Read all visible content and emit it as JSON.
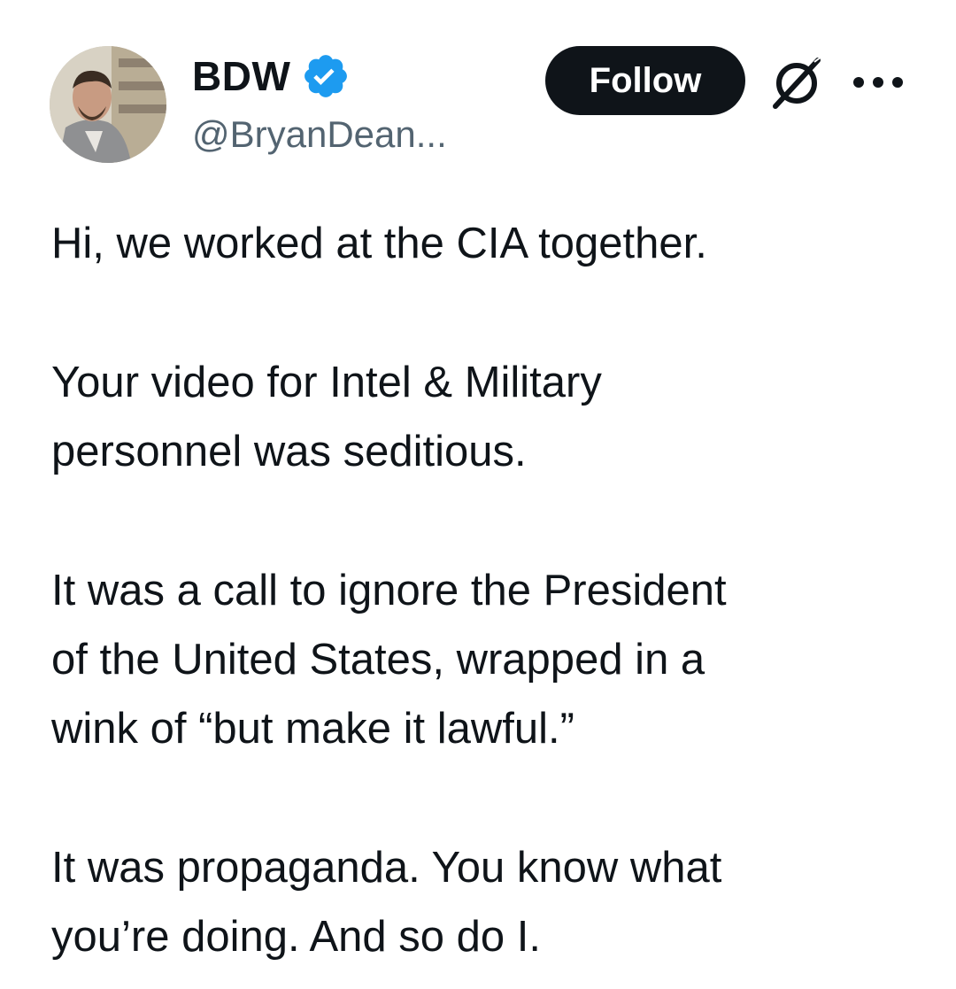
{
  "author": {
    "display_name": "BDW",
    "handle": "@BryanDean...",
    "verified": true,
    "verified_color": "#1d9bf0",
    "avatar_icon": "profile-photo"
  },
  "actions": {
    "follow_label": "Follow",
    "grok_icon": "grok-icon",
    "more_icon": "more-options-icon"
  },
  "tweet": {
    "paragraphs": [
      {
        "lines": [
          "Hi, we worked at the CIA together."
        ]
      },
      {
        "lines": [
          "Your video for Intel & Military",
          "personnel was seditious."
        ]
      },
      {
        "lines": [
          "It was a call to ignore the President",
          "of the United States, wrapped in a",
          "wink of “but make it lawful.”"
        ]
      },
      {
        "lines": [
          "It was propaganda. You know what",
          "you’re doing. And so do I."
        ]
      }
    ]
  },
  "colors": {
    "text": "#0f1419",
    "secondary_text": "#536471",
    "follow_bg": "#0f1419",
    "follow_text": "#ffffff"
  }
}
